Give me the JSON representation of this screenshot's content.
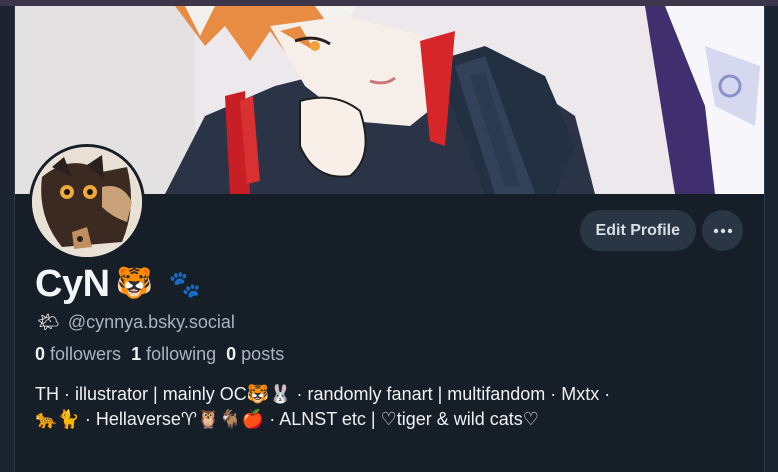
{
  "profile": {
    "display_name": "CyN",
    "name_emojis": [
      "🐯",
      "🐾"
    ],
    "handle_emoji": "🌤",
    "handle": "@cynnya.bsky.social",
    "followers_count": "0",
    "followers_label": "followers",
    "following_count": "1",
    "following_label": "following",
    "posts_count": "0",
    "posts_label": "posts",
    "bio_line1": "TH · illustrator | mainly OC🐯🐰 · randomly fanart | multifandom · Mxtx ·",
    "bio_line2": "🐆🐈 · Hellaverse♈🦉🐐🍎 · ALNST etc | ♡tiger & wild cats♡"
  },
  "actions": {
    "edit_profile_label": "Edit Profile",
    "more_icon": "ellipsis-icon"
  },
  "colors": {
    "background": "#161e27",
    "button_bg": "#2b3644",
    "muted_text": "#a9b4c2"
  }
}
